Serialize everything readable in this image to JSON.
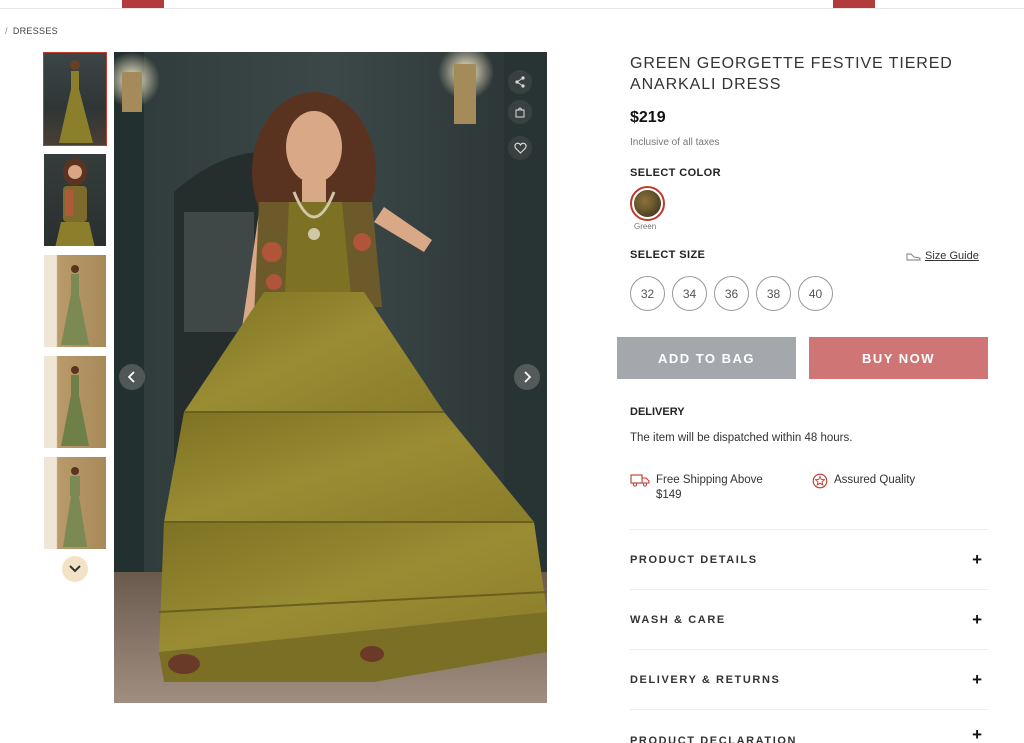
{
  "breadcrumb": {
    "separator": "/",
    "current": "DRESSES"
  },
  "product": {
    "title": "GREEN GEORGETTE FESTIVE TIERED ANARKALI DRESS",
    "price": "$219",
    "tax_note": "Inclusive of all taxes"
  },
  "color": {
    "label": "SELECT COLOR",
    "selected_name": "Green"
  },
  "size": {
    "label": "SELECT SIZE",
    "guide_label": "Size Guide",
    "options": [
      "32",
      "34",
      "36",
      "38",
      "40"
    ]
  },
  "actions": {
    "add_to_bag": "ADD TO BAG",
    "buy_now": "BUY NOW"
  },
  "delivery": {
    "title": "DELIVERY",
    "text": "The item will be dispatched within 48 hours.",
    "perks": [
      {
        "icon": "truck-icon",
        "text_line1": "Free Shipping Above",
        "text_line2": "$149"
      },
      {
        "icon": "quality-badge-icon",
        "text_line1": "Assured Quality",
        "text_line2": ""
      }
    ]
  },
  "accordion": [
    {
      "label": "PRODUCT DETAILS"
    },
    {
      "label": "WASH & CARE"
    },
    {
      "label": "DELIVERY & RETURNS"
    },
    {
      "label": "PRODUCT DECLARATION"
    }
  ],
  "gallery": {
    "thumbnail_count": 5,
    "active_index": 0,
    "icons": [
      "share-icon",
      "bag-icon",
      "heart-icon",
      "chevron-left-icon",
      "chevron-right-icon",
      "chevron-down-icon"
    ]
  },
  "colors": {
    "accent": "#c0392b",
    "add_to_bag_bg": "#a4a8ad",
    "buy_now_bg": "#cf7575",
    "dress_olive": "#8c7f2c"
  }
}
